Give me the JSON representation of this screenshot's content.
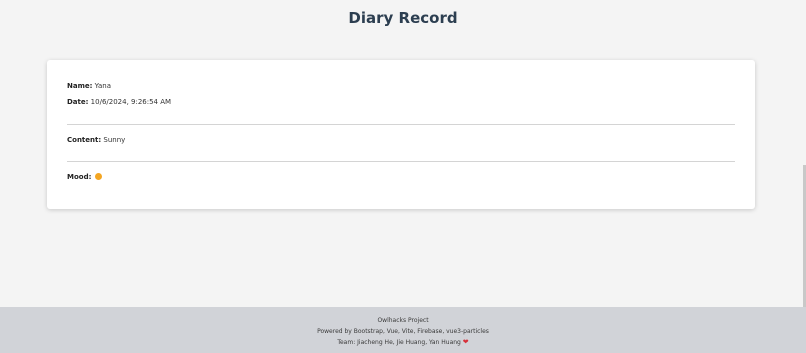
{
  "page": {
    "title": "Diary Record"
  },
  "record": {
    "name_label": "Name:",
    "name_value": "Yana",
    "date_label": "Date:",
    "date_value": "10/6/2024, 9:26:54 AM",
    "content_label": "Content:",
    "content_value": "Sunny",
    "mood_label": "Mood:",
    "mood_icon": "smiling-face-emoji"
  },
  "footer": {
    "line1": "Owlhacks Project",
    "line2": "Powered by Bootstrap, Vue, Vite, Firebase, vue3-particles",
    "line3": "Team: Jiacheng He, Jie Huang, Yan Huang",
    "heart_icon": "heart-icon",
    "heart_color": "#d6303a"
  }
}
